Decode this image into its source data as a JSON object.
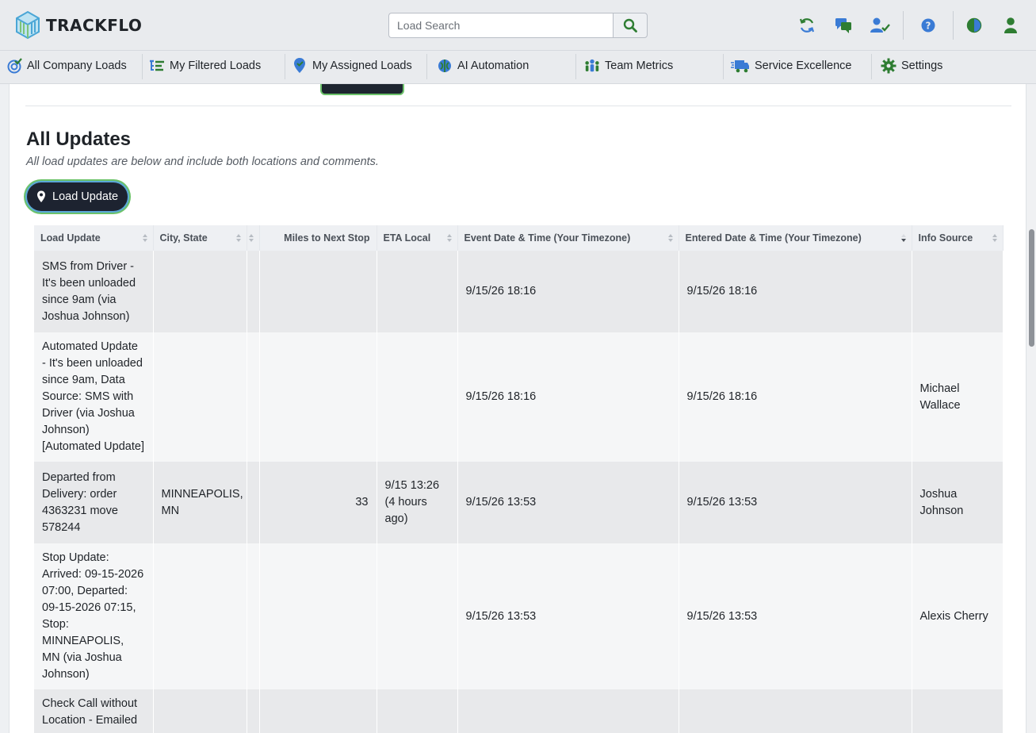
{
  "app": {
    "name": "TRACKFLO"
  },
  "colors": {
    "accent_green": "#2e7d32",
    "accent_blue": "#3a7bd5",
    "dark_button": "#1d2330"
  },
  "search": {
    "placeholder": "Load Search"
  },
  "header_icons": [
    "refresh-icon",
    "chat-icon",
    "user-check-icon",
    "help-icon",
    "contrast-icon",
    "user-icon"
  ],
  "nav": {
    "items": [
      {
        "label": "All Company Loads",
        "icon": "target-check-icon"
      },
      {
        "label": "My Filtered Loads",
        "icon": "filter-list-icon"
      },
      {
        "label": "My Assigned Loads",
        "icon": "map-pin-icon"
      },
      {
        "label": "AI Automation",
        "icon": "brain-icon"
      },
      {
        "label": "Team Metrics",
        "icon": "team-icon"
      },
      {
        "label": "Service Excellence",
        "icon": "truck-icon"
      },
      {
        "label": "Settings",
        "icon": "gear-icon"
      }
    ]
  },
  "section": {
    "title": "All Updates",
    "subtitle": "All load updates are below and include both locations and comments.",
    "button": "Load Update"
  },
  "table": {
    "columns": [
      "Load Update",
      "City, State",
      "",
      "Miles to Next Stop",
      "ETA Local",
      "Event Date & Time (Your Timezone)",
      "Entered Date & Time (Your Timezone)",
      "Info Source"
    ],
    "rows": [
      {
        "update": "SMS from Driver - It's been unloaded since 9am (via Joshua Johnson)",
        "city": "",
        "blank": "",
        "miles": "",
        "eta": "",
        "event": "9/15/26 18:16",
        "entered": "9/15/26 18:16",
        "source": ""
      },
      {
        "update": "Automated Update - It's been unloaded since 9am, Data Source: SMS with Driver (via Joshua Johnson) [Automated Update]",
        "city": "",
        "blank": "",
        "miles": "",
        "eta": "",
        "event": "9/15/26 18:16",
        "entered": "9/15/26 18:16",
        "source": "Michael Wallace"
      },
      {
        "update": "Departed from Delivery: order 4363231 move 578244",
        "city": "MINNEAPOLIS, MN",
        "blank": "",
        "miles": "33",
        "eta": "9/15 13:26 (4 hours ago)",
        "event": "9/15/26 13:53",
        "entered": "9/15/26 13:53",
        "source": "Joshua Johnson"
      },
      {
        "update": "Stop Update: Arrived: 09-15-2026 07:00, Departed: 09-15-2026 07:15, Stop: MINNEAPOLIS, MN (via Joshua Johnson)",
        "city": "",
        "blank": "",
        "miles": "",
        "eta": "",
        "event": "9/15/26 13:53",
        "entered": "9/15/26 13:53",
        "source": "Alexis Cherry"
      },
      {
        "update": "Check Call without Location - Emailed",
        "city": "",
        "blank": "",
        "miles": "",
        "eta": "",
        "event": "",
        "entered": "",
        "source": ""
      }
    ]
  }
}
